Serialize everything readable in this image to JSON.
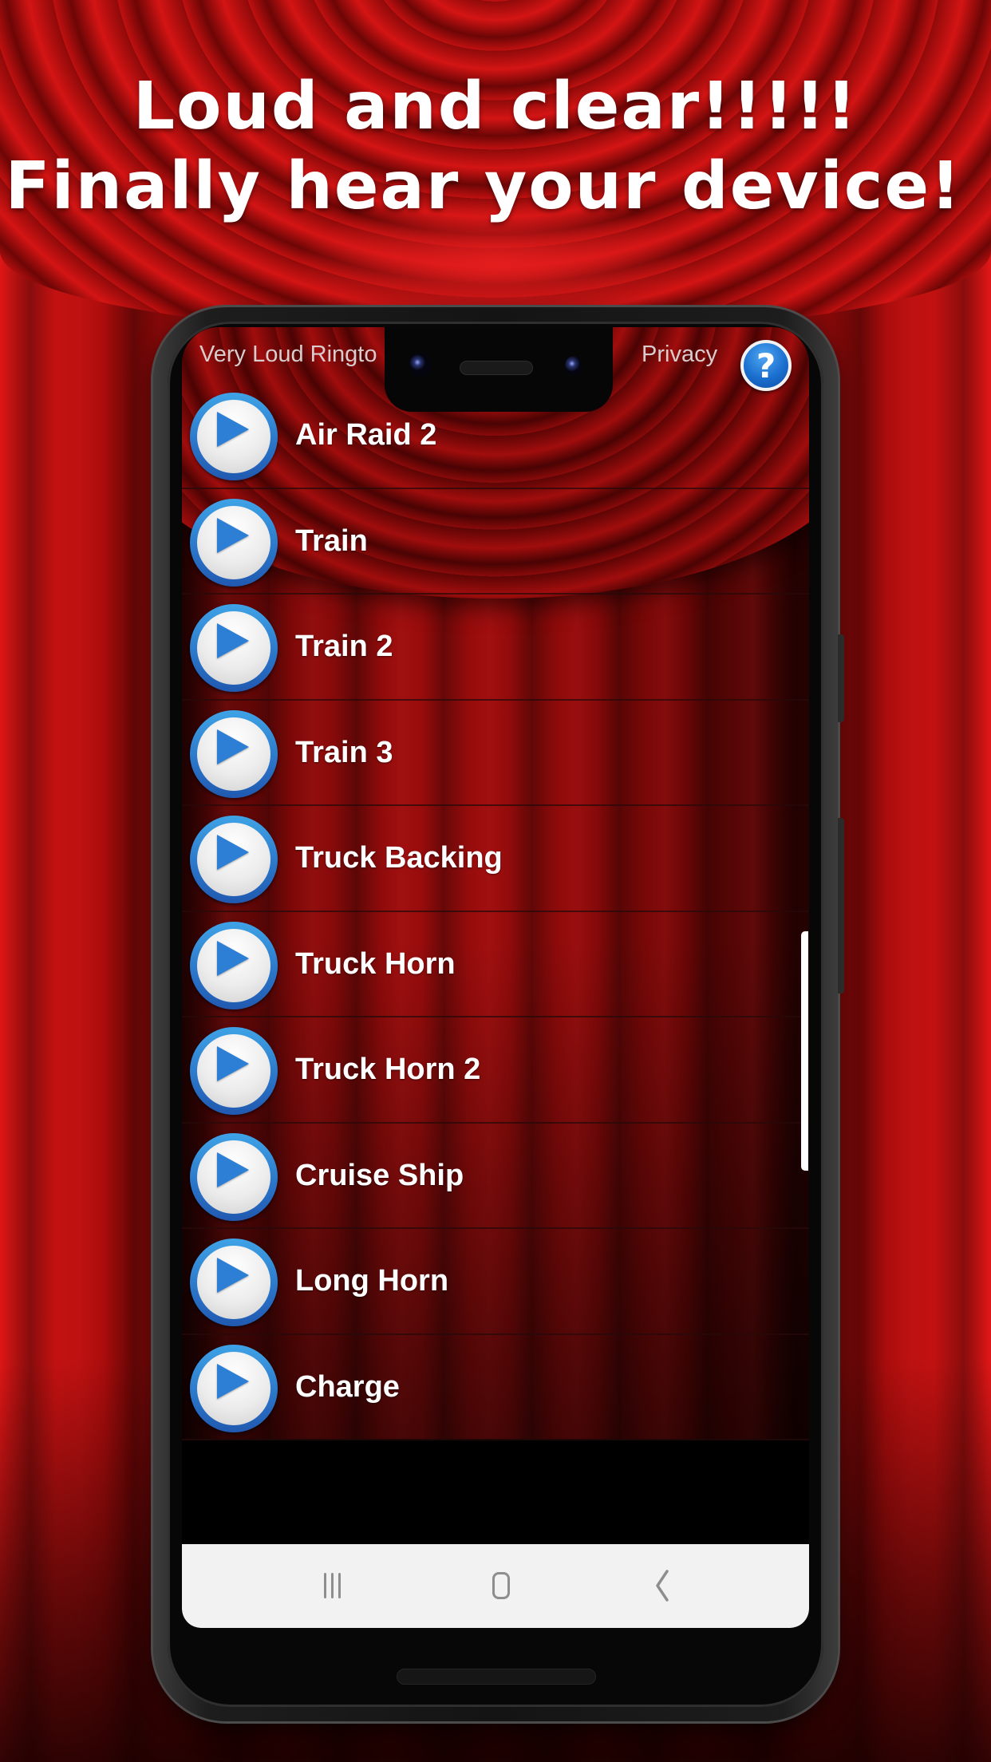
{
  "promo": {
    "headline_line1": "Loud and clear!!!!!",
    "headline_line2": "Finally hear your device!"
  },
  "app": {
    "title": "Very Loud Ringto",
    "privacy_label": "Privacy",
    "help_icon": "help-question-icon",
    "help_glyph": "?"
  },
  "colors": {
    "curtain_red": "#c41010",
    "play_button_blue": "#2a74c8",
    "help_button_blue": "#1a6fcf",
    "nav_bar_bg": "#f2f2f2"
  },
  "sounds": [
    {
      "label": "Air Raid 2",
      "icon": "play-icon"
    },
    {
      "label": "Train",
      "icon": "play-icon"
    },
    {
      "label": "Train 2",
      "icon": "play-icon"
    },
    {
      "label": "Train 3",
      "icon": "play-icon"
    },
    {
      "label": "Truck Backing",
      "icon": "play-icon"
    },
    {
      "label": "Truck Horn",
      "icon": "play-icon"
    },
    {
      "label": "Truck Horn 2",
      "icon": "play-icon"
    },
    {
      "label": "Cruise Ship",
      "icon": "play-icon"
    },
    {
      "label": "Long Horn",
      "icon": "play-icon"
    },
    {
      "label": "Charge",
      "icon": "play-icon"
    }
  ],
  "navigation": {
    "recents_icon": "recent-apps-icon",
    "home_icon": "home-icon",
    "back_icon": "back-chevron-icon"
  }
}
